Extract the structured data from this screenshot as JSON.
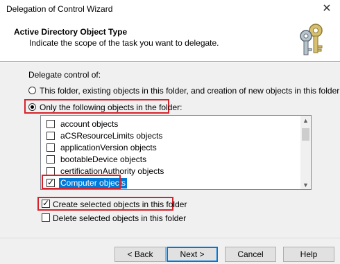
{
  "window": {
    "title": "Delegation of Control Wizard",
    "close_symbol": "✕"
  },
  "header": {
    "title": "Active Directory Object Type",
    "subtitle": "Indicate the scope of the task you want to delegate.",
    "icon": "keys-icon"
  },
  "delegate_label": "Delegate control of:",
  "options": {
    "this_folder": {
      "label": "This folder, existing objects in this folder, and creation of new objects in this folder",
      "checked": false
    },
    "only_following": {
      "label": "Only the following objects in the folder:",
      "checked": true
    }
  },
  "object_list": [
    {
      "label": "account objects",
      "checked": false,
      "selected": false
    },
    {
      "label": "aCSResourceLimits objects",
      "checked": false,
      "selected": false
    },
    {
      "label": "applicationVersion objects",
      "checked": false,
      "selected": false
    },
    {
      "label": "bootableDevice objects",
      "checked": false,
      "selected": false
    },
    {
      "label": "certificationAuthority objects",
      "checked": false,
      "selected": false
    },
    {
      "label": "Computer objects",
      "checked": true,
      "selected": true
    }
  ],
  "create_selected": {
    "label": "Create selected objects in this folder",
    "checked": true
  },
  "delete_selected": {
    "label": "Delete selected objects in this folder",
    "checked": false
  },
  "buttons": {
    "back": "< Back",
    "next": "Next >",
    "cancel": "Cancel",
    "help": "Help"
  },
  "colors": {
    "highlight_border": "#d6222a",
    "selection": "#0078d7"
  }
}
